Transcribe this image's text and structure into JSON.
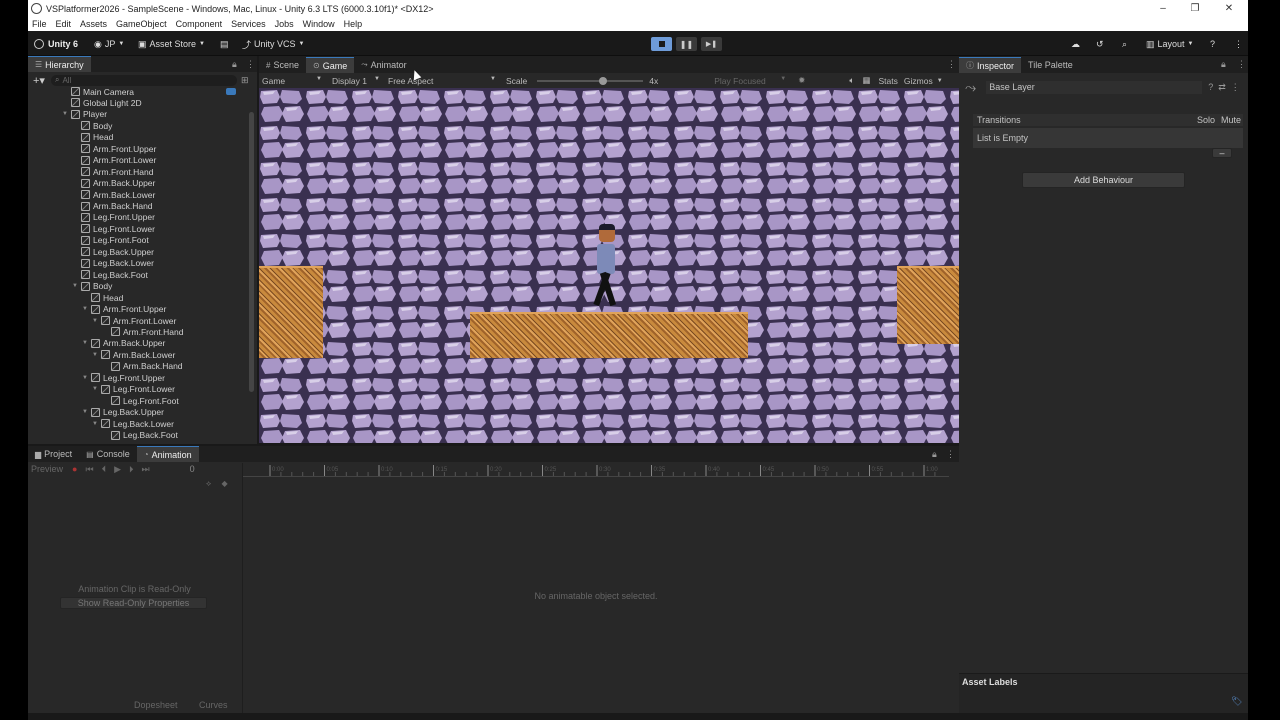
{
  "window": {
    "title": "VSPlatformer2026 - SampleScene - Windows, Mac, Linux - Unity 6.3 LTS (6000.3.10f1)* <DX12>",
    "controls": [
      "–",
      "❐",
      "✕"
    ]
  },
  "menu": [
    "File",
    "Edit",
    "Assets",
    "GameObject",
    "Component",
    "Services",
    "Jobs",
    "Window",
    "Help"
  ],
  "toolbar": {
    "unity_label": "Unity 6",
    "account": "JP",
    "asset_store": "Asset Store",
    "vcs": "Unity VCS",
    "layout": "Layout"
  },
  "hierarchy": {
    "tab": "Hierarchy",
    "search_placeholder": "All",
    "items": [
      {
        "label": "Main Camera",
        "depth": 1,
        "arrow": ""
      },
      {
        "label": "Global Light 2D",
        "depth": 1,
        "arrow": ""
      },
      {
        "label": "Player",
        "depth": 1,
        "arrow": "▼"
      },
      {
        "label": "Body",
        "depth": 2,
        "arrow": ""
      },
      {
        "label": "Head",
        "depth": 2,
        "arrow": ""
      },
      {
        "label": "Arm.Front.Upper",
        "depth": 2,
        "arrow": ""
      },
      {
        "label": "Arm.Front.Lower",
        "depth": 2,
        "arrow": ""
      },
      {
        "label": "Arm.Front.Hand",
        "depth": 2,
        "arrow": ""
      },
      {
        "label": "Arm.Back.Upper",
        "depth": 2,
        "arrow": ""
      },
      {
        "label": "Arm.Back.Lower",
        "depth": 2,
        "arrow": ""
      },
      {
        "label": "Arm.Back.Hand",
        "depth": 2,
        "arrow": ""
      },
      {
        "label": "Leg.Front.Upper",
        "depth": 2,
        "arrow": ""
      },
      {
        "label": "Leg.Front.Lower",
        "depth": 2,
        "arrow": ""
      },
      {
        "label": "Leg.Front.Foot",
        "depth": 2,
        "arrow": ""
      },
      {
        "label": "Leg.Back.Upper",
        "depth": 2,
        "arrow": ""
      },
      {
        "label": "Leg.Back.Lower",
        "depth": 2,
        "arrow": ""
      },
      {
        "label": "Leg.Back.Foot",
        "depth": 2,
        "arrow": ""
      },
      {
        "label": "Body",
        "depth": 2,
        "arrow": "▼"
      },
      {
        "label": "Head",
        "depth": 3,
        "arrow": ""
      },
      {
        "label": "Arm.Front.Upper",
        "depth": 3,
        "arrow": "▼"
      },
      {
        "label": "Arm.Front.Lower",
        "depth": 4,
        "arrow": "▼"
      },
      {
        "label": "Arm.Front.Hand",
        "depth": 5,
        "arrow": ""
      },
      {
        "label": "Arm.Back.Upper",
        "depth": 3,
        "arrow": "▼"
      },
      {
        "label": "Arm.Back.Lower",
        "depth": 4,
        "arrow": "▼"
      },
      {
        "label": "Arm.Back.Hand",
        "depth": 5,
        "arrow": ""
      },
      {
        "label": "Leg.Front.Upper",
        "depth": 3,
        "arrow": "▼"
      },
      {
        "label": "Leg.Front.Lower",
        "depth": 4,
        "arrow": "▼"
      },
      {
        "label": "Leg.Front.Foot",
        "depth": 5,
        "arrow": ""
      },
      {
        "label": "Leg.Back.Upper",
        "depth": 3,
        "arrow": "▼"
      },
      {
        "label": "Leg.Back.Lower",
        "depth": 4,
        "arrow": "▼"
      },
      {
        "label": "Leg.Back.Foot",
        "depth": 5,
        "arrow": ""
      }
    ]
  },
  "center_tabs": {
    "scene": "Scene",
    "game": "Game",
    "animator": "Animator"
  },
  "game_bar": {
    "mode": "Game",
    "display": "Display 1",
    "aspect": "Free Aspect",
    "scale_label": "Scale",
    "scale_value": "4x",
    "play_focused": "Play Focused",
    "stats": "Stats",
    "gizmos": "Gizmos"
  },
  "inspector": {
    "tab": "Inspector",
    "tab2": "Tile Palette",
    "layer_name": "Base Layer",
    "transitions_header": "Transitions",
    "solo": "Solo",
    "mute": "Mute",
    "list_empty": "List is Empty",
    "minus": "–",
    "add_behaviour": "Add Behaviour",
    "asset_labels": "Asset Labels"
  },
  "bottom_tabs": {
    "project": "Project",
    "console": "Console",
    "animation": "Animation"
  },
  "animation": {
    "preview": "Preview",
    "frame": "0",
    "read_only": "Animation Clip is Read-Only",
    "show_props": "Show Read-Only Properties",
    "no_object": "No animatable object selected.",
    "dopesheet": "Dopesheet",
    "curves": "Curves",
    "ruler_labels": [
      "0:00",
      "0:05",
      "0:10",
      "0:15",
      "0:20",
      "0:25",
      "0:30",
      "0:35",
      "0:40",
      "0:45",
      "0:50",
      "0:55",
      "1:00"
    ]
  },
  "colors": {
    "accent": "#3a79bb",
    "play_active": "#6e9bd8",
    "stone": "#b4a2cf",
    "stone_dark": "#3a3050",
    "dirt": "#c98a3d"
  }
}
